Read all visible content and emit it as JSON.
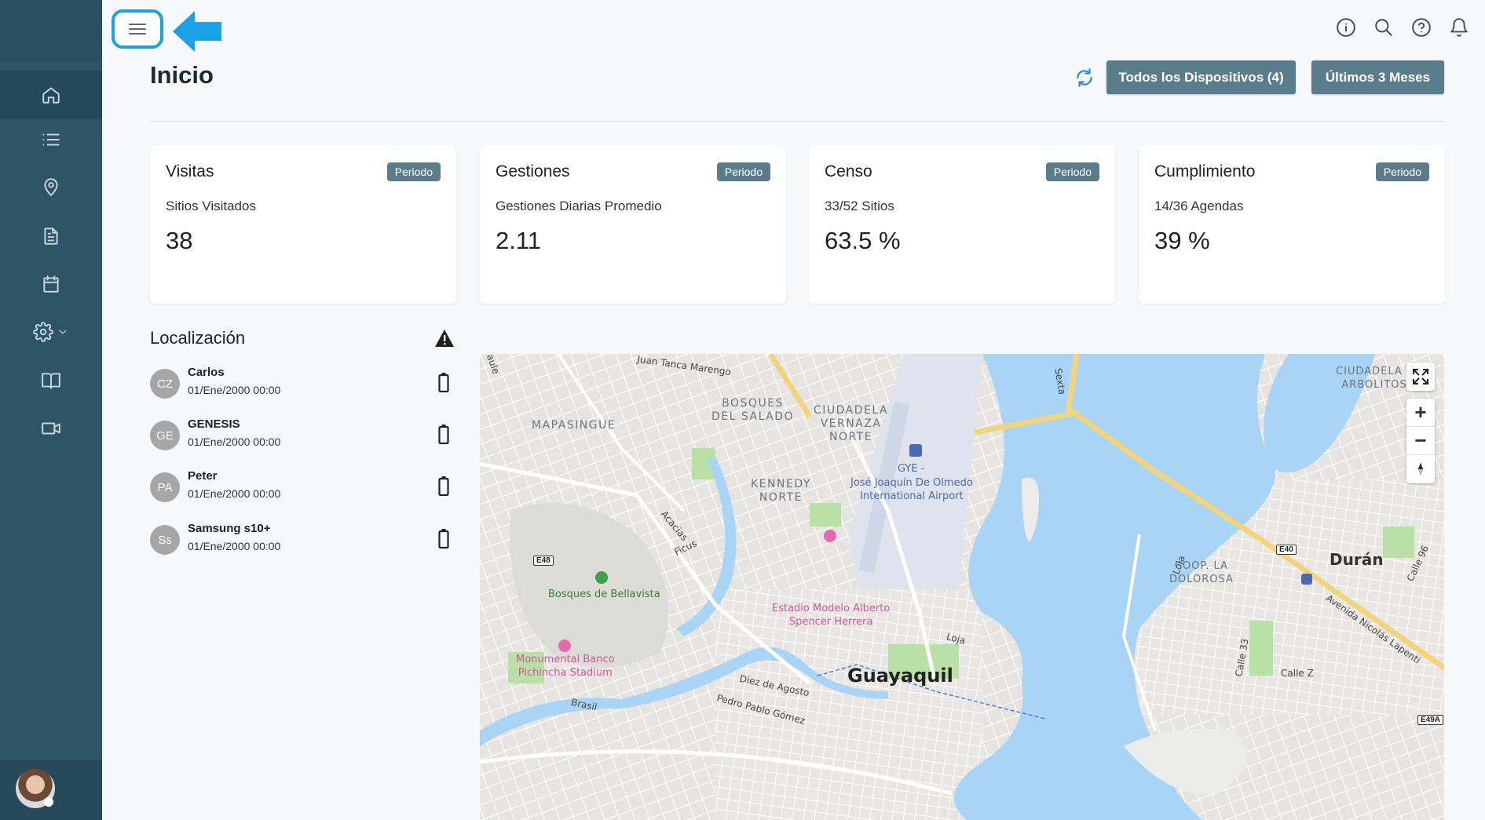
{
  "page": {
    "title": "Inicio"
  },
  "header": {
    "devices_button": "Todos los Dispositivos (4)",
    "period_button": "Últimos 3 Meses"
  },
  "cards": [
    {
      "title": "Visitas",
      "badge": "Periodo",
      "subtitle": "Sitios Visitados",
      "value": "38"
    },
    {
      "title": "Gestiones",
      "badge": "Periodo",
      "subtitle": "Gestiones Diarias Promedio",
      "value": "2.11"
    },
    {
      "title": "Censo",
      "badge": "Periodo",
      "subtitle": "33/52 Sitios",
      "value": "63.5 %"
    },
    {
      "title": "Cumplimiento",
      "badge": "Periodo",
      "subtitle": "14/36 Agendas",
      "value": "39 %"
    }
  ],
  "location": {
    "title": "Localización",
    "devices": [
      {
        "initials": "CZ",
        "name": "Carlos",
        "time": "01/Ene/2000 00:00"
      },
      {
        "initials": "GE",
        "name": "GENESIS",
        "time": "01/Ene/2000 00:00"
      },
      {
        "initials": "PA",
        "name": "Peter",
        "time": "01/Ene/2000 00:00"
      },
      {
        "initials": "Ss",
        "name": "Samsung s10+",
        "time": "01/Ene/2000 00:00"
      }
    ]
  },
  "map": {
    "labels": {
      "juan_tanca": "Juan Tanca Marengo",
      "mapasingue": "MAPASINGUE",
      "bosques_salado": "BOSQUES\nDEL SALADO",
      "ciudadela_vernaza": "CIUDADELA\nVERNAZA\nNORTE",
      "kennedy": "KENNEDY\nNORTE",
      "airport_code": "GYE -",
      "airport": "José Joaquín De Olmedo\nInternational Airport",
      "sexta": "Sexta",
      "ciudadela_arbolitos": "CIUDADELA L\nARBOLITOS",
      "acacias": "Acacias",
      "ficus": "Ficus",
      "e48": "E48",
      "e40": "E40",
      "e49a": "E49A",
      "bellavista": "Bosques de Bellavista",
      "estadio": "Estadio Modelo Alberto\nSpencer Herrera",
      "monumental": "Monumental Banco\nPichincha Stadium",
      "guayaquil": "Guayaquil",
      "loja1": "Loja",
      "loja2": "Loja",
      "diez_agosto": "Diez de Agosto",
      "pedro_pablo": "Pedro Pablo Gómez",
      "brasil": "Brasil",
      "duran": "Durán",
      "dolorosa": "COOP. LA\nDOLOROSA",
      "calle33": "Calle 33",
      "callez": "Calle Z",
      "avenida": "Avenida Nicolás Lapenti",
      "calle96": "Calle 96",
      "aule": "aule"
    }
  },
  "colors": {
    "sidebar": "#2d5566",
    "button": "#5a7d8c",
    "highlight": "#1aa1e6",
    "water": "#a8d4f5"
  },
  "icons": {
    "sidebar": [
      "home-icon",
      "list-icon",
      "location-pin-icon",
      "document-icon",
      "calendar-icon",
      "gear-icon",
      "book-icon",
      "video-icon"
    ],
    "topbar": [
      "info-icon",
      "search-icon",
      "help-icon",
      "bell-icon"
    ]
  }
}
